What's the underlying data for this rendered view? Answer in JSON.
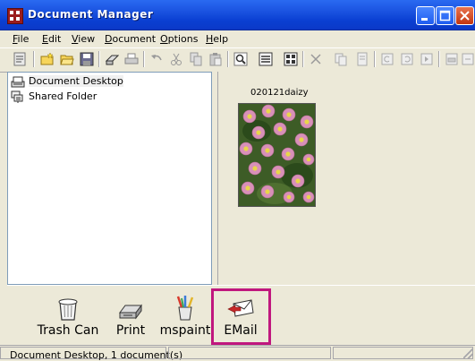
{
  "window": {
    "title": "Document Manager",
    "controls": [
      "minimize-icon",
      "maximize-icon",
      "close-icon"
    ]
  },
  "menu": {
    "items": [
      {
        "key": "F",
        "rest": "ile"
      },
      {
        "key": "E",
        "rest": "dit"
      },
      {
        "key": "V",
        "rest": "iew"
      },
      {
        "key": "D",
        "rest": "ocument"
      },
      {
        "key": "O",
        "rest": "ptions"
      },
      {
        "key": "H",
        "rest": "elp"
      }
    ]
  },
  "toolbar": {
    "icons": [
      "properties-icon",
      "new-folder-icon",
      "open-folder-icon",
      "save-icon",
      "scan-icon",
      "print-icon",
      "undo-icon",
      "cut-icon",
      "copy-icon",
      "paste-icon",
      "find-icon",
      "details-view-icon",
      "thumbnail-view-icon",
      "delete-icon",
      "copy-page-icon",
      "page-icon",
      "rotate-left-icon",
      "rotate-right-icon",
      "next-page-icon",
      "print-page-icon",
      "export-icon"
    ]
  },
  "tree": {
    "items": [
      {
        "label": "Document Desktop",
        "icon": "desktop-tray-icon",
        "selected": true
      },
      {
        "label": "Shared Folder",
        "icon": "network-folder-icon",
        "selected": false
      }
    ]
  },
  "documents": [
    {
      "name": "020121daizy",
      "icon": "flower-photo-thumbnail"
    }
  ],
  "targets": [
    {
      "label": "Trash Can",
      "icon": "trash-can-icon"
    },
    {
      "label": "Print",
      "icon": "printer-icon"
    },
    {
      "label": "mspaint",
      "icon": "paint-brushes-icon"
    },
    {
      "label": "EMail",
      "icon": "email-envelope-icon",
      "highlighted": true
    }
  ],
  "status": {
    "text": "Document Desktop, 1 document(s)"
  },
  "colors": {
    "titlebar": "#0a3fd2",
    "highlight": "#c0177e",
    "window": "#ece9d8"
  }
}
